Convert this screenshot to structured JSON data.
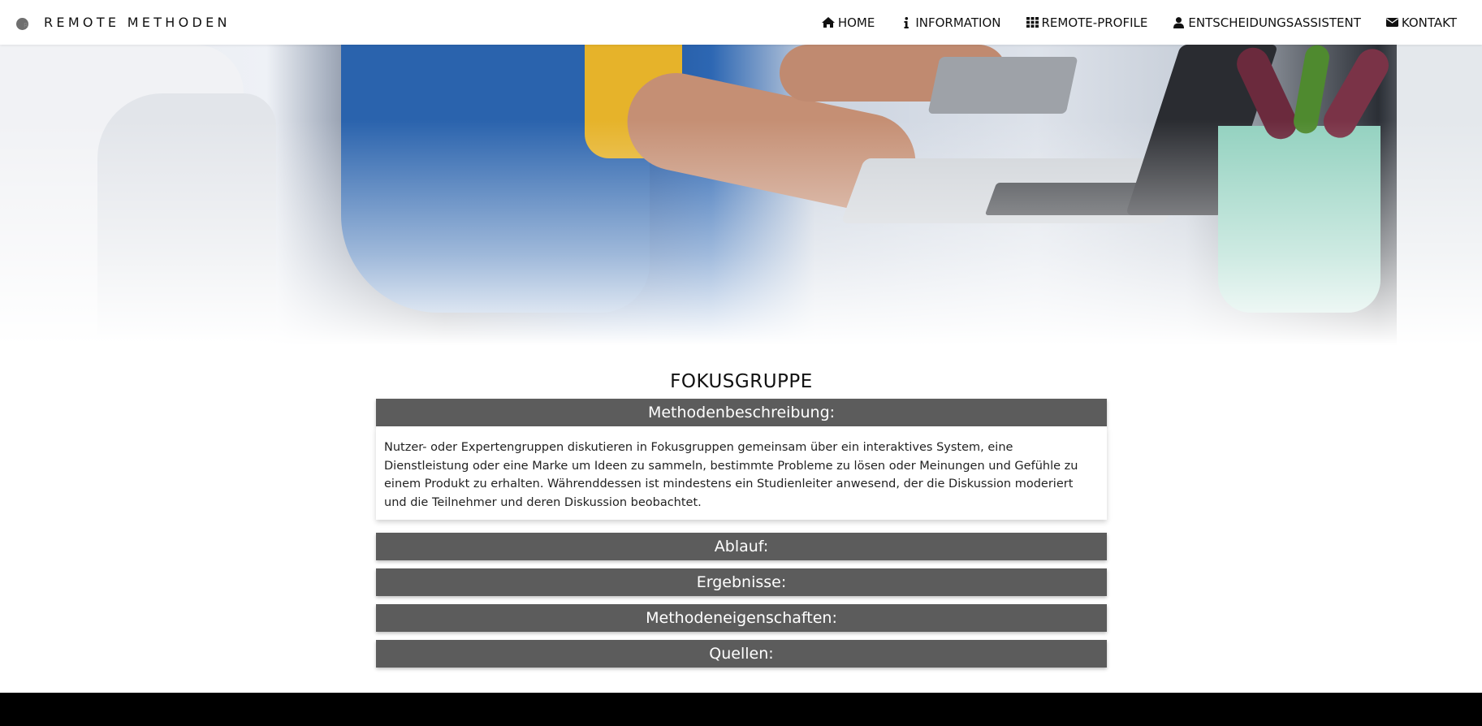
{
  "brand": {
    "title": "REMOTE METHODEN",
    "logo_icon": "remote-logo-icon"
  },
  "nav": {
    "items": [
      {
        "label": "HOME",
        "icon": "home-icon"
      },
      {
        "label": "INFORMATION",
        "icon": "info-icon"
      },
      {
        "label": "REMOTE-PROFILE",
        "icon": "grid-icon"
      },
      {
        "label": "ENTSCHEIDUNGSASSISTENT",
        "icon": "user-icon"
      },
      {
        "label": "KONTAKT",
        "icon": "envelope-icon"
      }
    ]
  },
  "hero": {
    "description": "office workspace photo"
  },
  "page": {
    "title": "FOKUSGRUPPE",
    "sections": [
      {
        "title": "Methodenbeschreibung:",
        "expanded": true,
        "body": "Nutzer- oder Expertengruppen diskutieren in Fokusgruppen gemeinsam über ein interaktives System, eine Dienstleistung oder eine Marke um Ideen zu sammeln, bestimmte Probleme zu lösen oder Meinungen und Gefühle zu einem Produkt zu erhalten. Währenddessen ist mindestens ein Studienleiter anwesend, der die Diskussion moderiert und die Teilnehmer und deren Diskussion beobachtet."
      },
      {
        "title": "Ablauf:",
        "expanded": false
      },
      {
        "title": "Ergebnisse:",
        "expanded": false
      },
      {
        "title": "Methodeneigenschaften:",
        "expanded": false
      },
      {
        "title": "Quellen:",
        "expanded": false
      }
    ]
  },
  "colors": {
    "accordion_header": "#5c5c5c",
    "footer": "#000000",
    "nav_background": "#ffffff"
  }
}
